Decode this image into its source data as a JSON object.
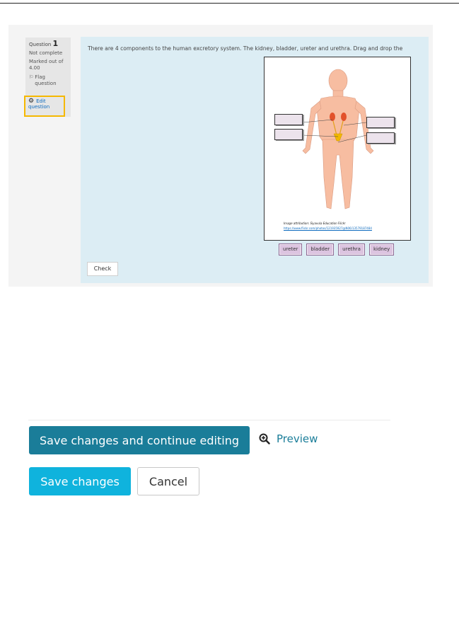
{
  "question_info": {
    "question_label": "Question",
    "question_number": "1",
    "state": "Not complete",
    "marked_out_of": "Marked out of 4.00",
    "flag_label": "Flag question",
    "edit_label": "Edit question"
  },
  "question": {
    "text": "There are 4 components to the human excretory system. The kidney, bladder, ureter and urethra. Drag and drop the",
    "attribution": "Image attribution: Siyavula Education Flickr",
    "attribution_link": "https://www.flickr.com/photos/121935927@N06/13579187484",
    "choices": [
      "ureter",
      "bladder",
      "urethra",
      "kidney"
    ],
    "check_label": "Check"
  },
  "actions": {
    "save_continue_label": "Save changes and continue editing",
    "preview_label": "Preview",
    "save_label": "Save changes",
    "cancel_label": "Cancel"
  },
  "icons": {
    "flag": "flag-icon",
    "gear": "gear-icon",
    "preview": "zoom-in-icon"
  },
  "colors": {
    "question_bg": "#dcedf4",
    "highlight": "#f5b800",
    "primary_dark": "#1a7d99",
    "primary": "#0fb3dd",
    "choice_bg": "#dcc4e0"
  }
}
